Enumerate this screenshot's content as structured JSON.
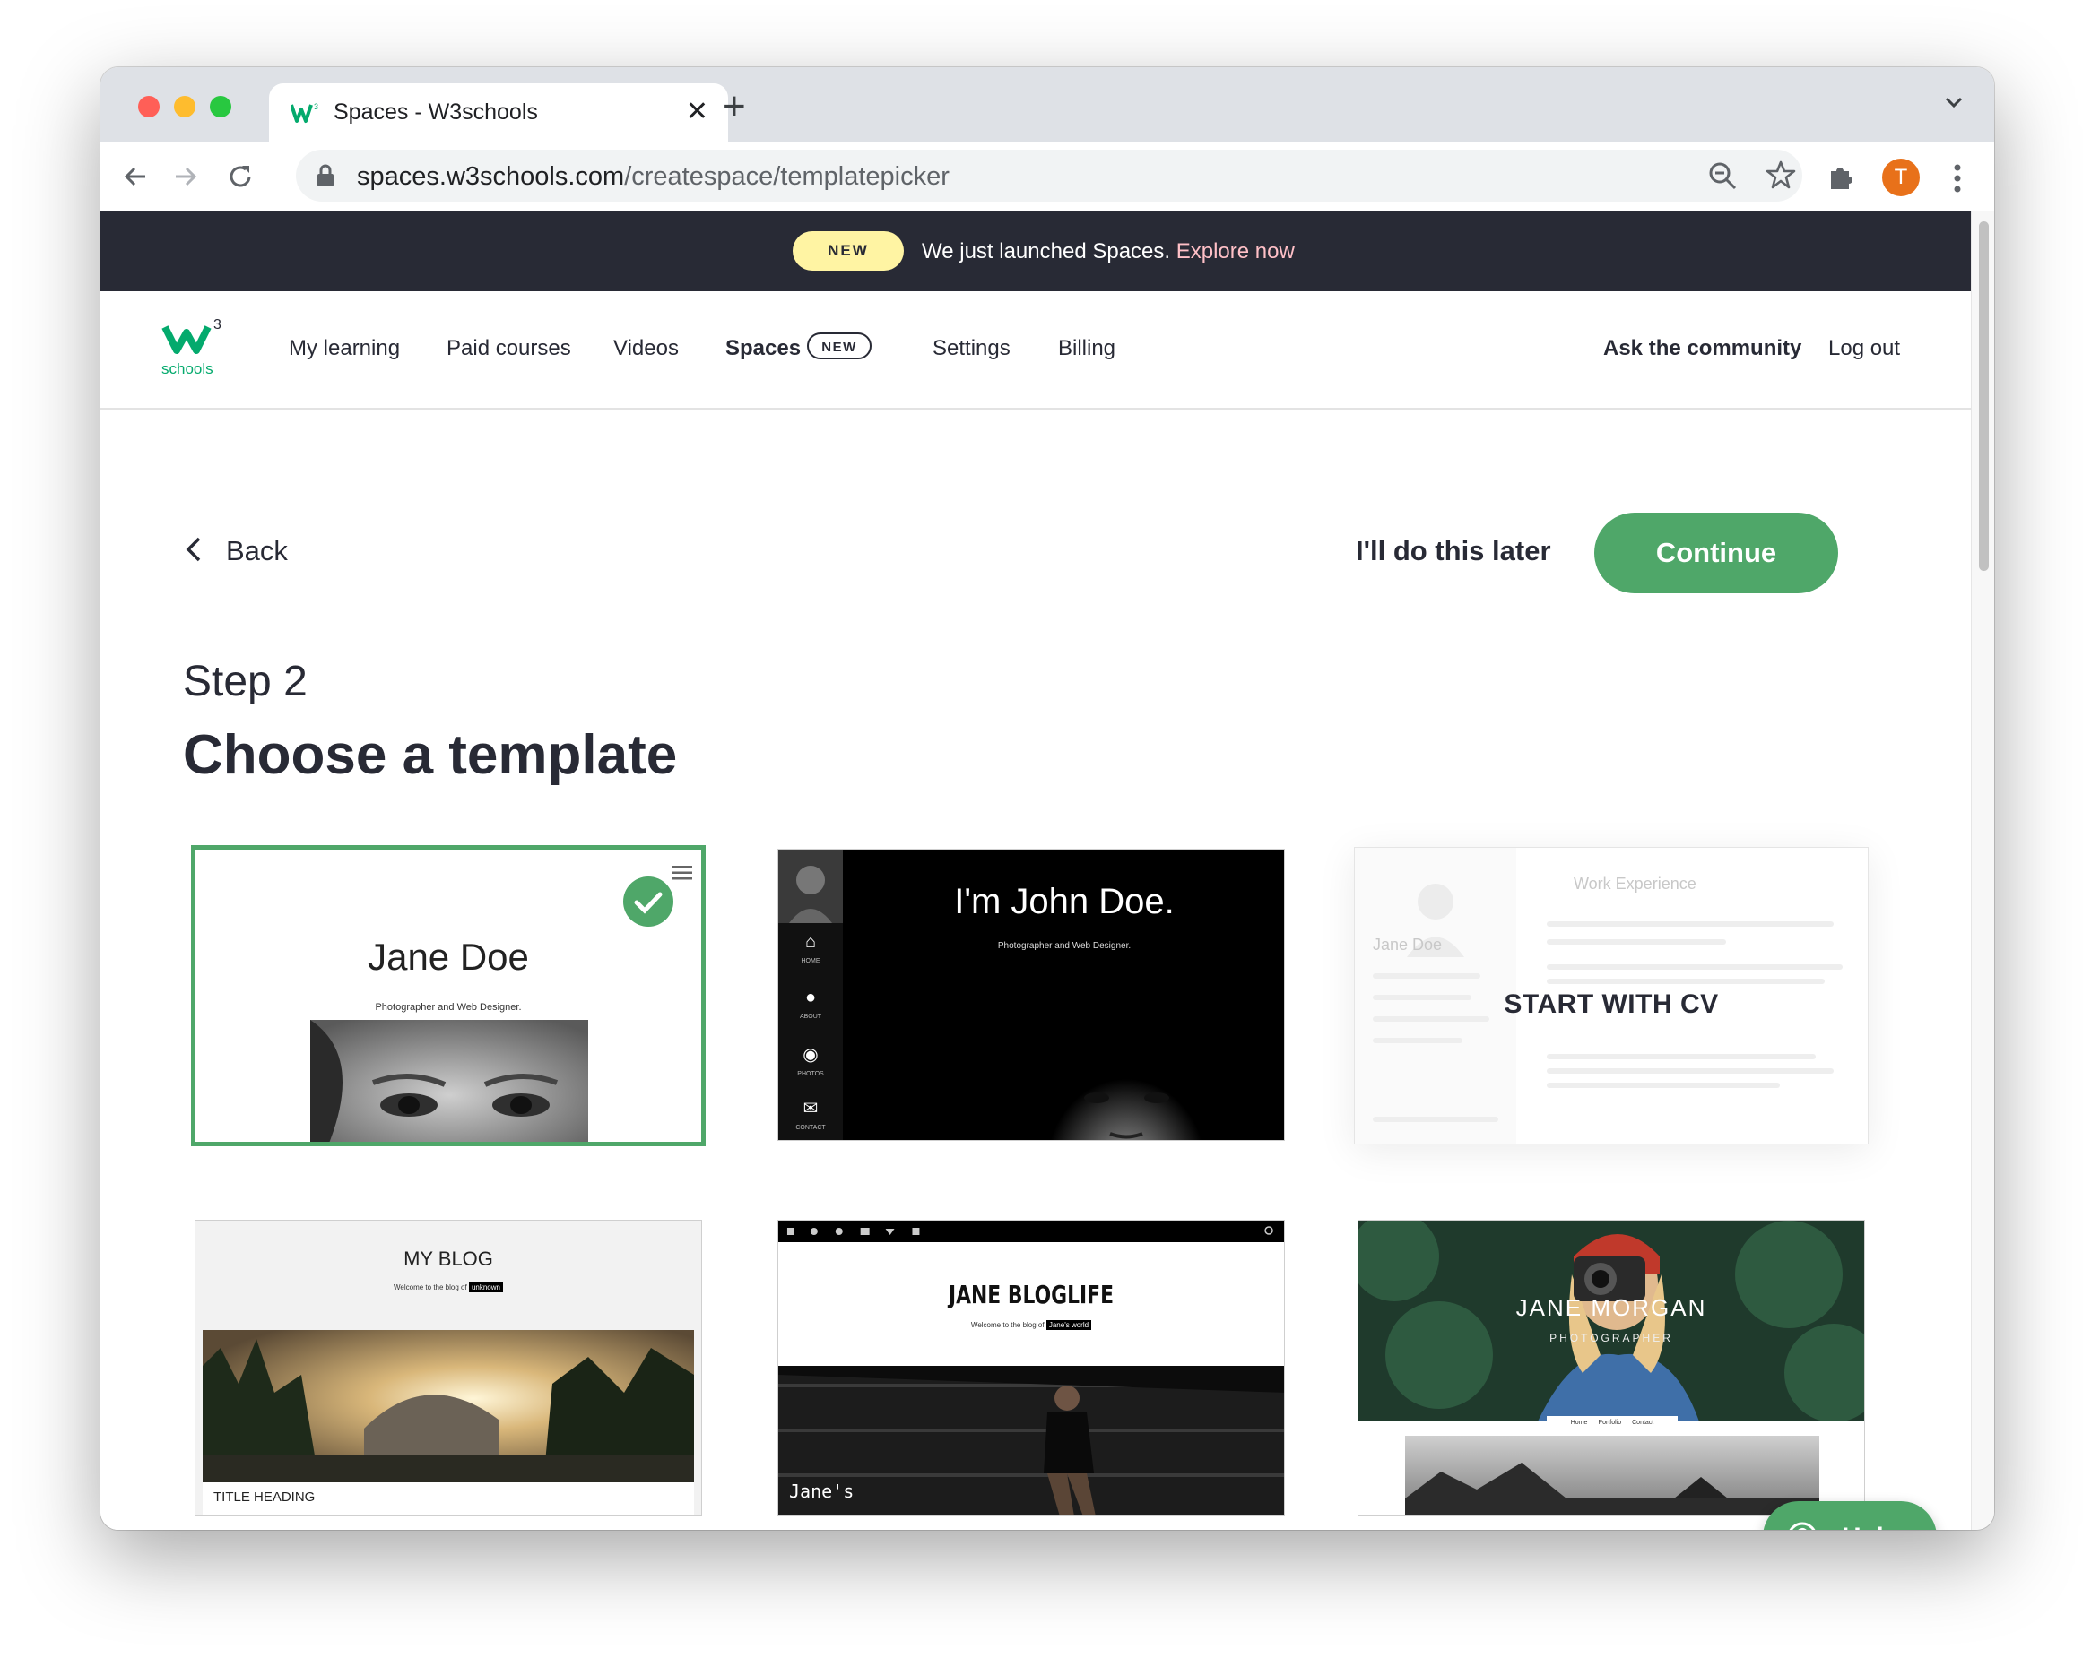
{
  "browser": {
    "tab_title": "Spaces - W3schools",
    "tab_close": "✕",
    "new_tab": "+",
    "url_host": "spaces.w3schools.com",
    "url_path": "/createspace/templatepicker",
    "profile_initial": "T"
  },
  "banner": {
    "badge": "NEW",
    "text": "We just launched Spaces.",
    "link": "Explore now"
  },
  "nav": {
    "logo_text": "schools",
    "logo_sup": "3",
    "items": [
      "My learning",
      "Paid courses",
      "Videos",
      "Spaces",
      "Settings",
      "Billing"
    ],
    "spaces_badge": "NEW",
    "right": [
      "Ask the community",
      "Log out"
    ]
  },
  "actions": {
    "back": "Back",
    "later": "I'll do this later",
    "continue": "Continue"
  },
  "step": {
    "label": "Step 2",
    "title": "Choose a template"
  },
  "templates": [
    {
      "id": "jane-doe",
      "name": "Jane Doe",
      "subtitle": "Photographer and Web Designer.",
      "selected": true
    },
    {
      "id": "john-doe",
      "name": "I'm John Doe.",
      "subtitle": "Photographer and Web Designer.",
      "menu": [
        "HOME",
        "ABOUT",
        "PHOTOS",
        "CONTACT"
      ]
    },
    {
      "id": "cv",
      "cta": "START WITH CV",
      "faint_title": "Work Experience",
      "faint_name": "Jane Doe"
    },
    {
      "id": "my-blog",
      "name": "MY BLOG",
      "subtitle": "Welcome to the blog of",
      "highlight": "unknown",
      "heading": "TITLE HEADING"
    },
    {
      "id": "jane-bloglife",
      "name": "JANE BLOGLIFE",
      "subtitle": "Welcome to the blog of",
      "highlight": "Jane's world",
      "signature": "Jane's"
    },
    {
      "id": "jane-morgan",
      "name": "JANE MORGAN",
      "role": "PHOTOGRAPHER",
      "menu": [
        "Home",
        "Portfolio",
        "Contact"
      ]
    }
  ],
  "help": {
    "label": "Help"
  },
  "colors": {
    "brand_green": "#4fa769",
    "banner_bg": "#282a35",
    "badge_yellow": "#fff4a3",
    "link_pink": "#ffc0c7"
  }
}
